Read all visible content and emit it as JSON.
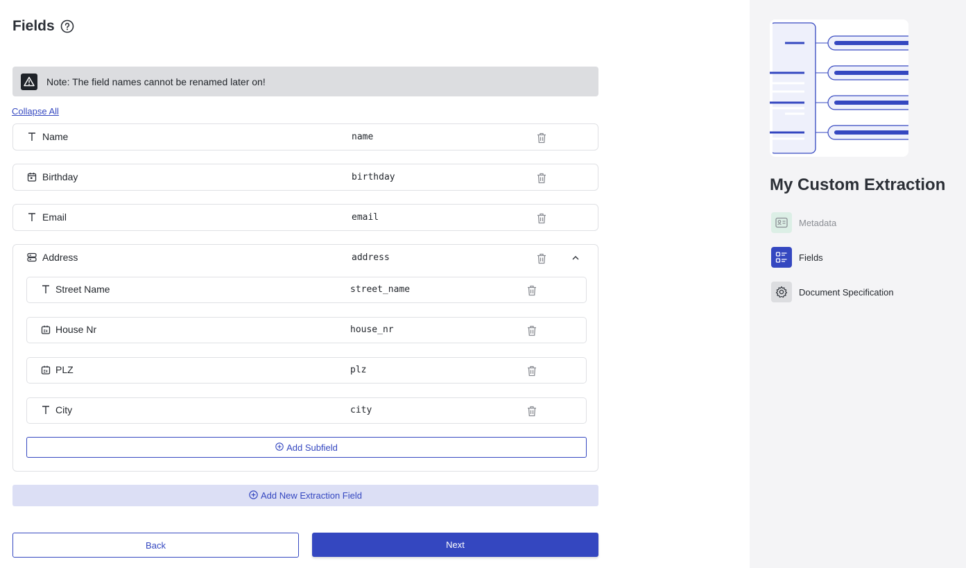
{
  "page": {
    "title": "Fields",
    "note": "Note: The field names cannot be renamed later on!",
    "collapse_all": "Collapse All"
  },
  "fields": [
    {
      "icon": "text-type-icon",
      "label": "Name",
      "key": "name"
    },
    {
      "icon": "calendar-icon",
      "label": "Birthday",
      "key": "birthday"
    },
    {
      "icon": "text-type-icon",
      "label": "Email",
      "key": "email"
    },
    {
      "icon": "group-icon",
      "label": "Address",
      "key": "address",
      "subfields": [
        {
          "icon": "text-type-icon",
          "label": "Street Name",
          "key": "street_name"
        },
        {
          "icon": "number-type-icon",
          "label": "House Nr",
          "key": "house_nr"
        },
        {
          "icon": "number-type-icon",
          "label": "PLZ",
          "key": "plz"
        },
        {
          "icon": "text-type-icon",
          "label": "City",
          "key": "city"
        }
      ]
    }
  ],
  "actions": {
    "add_subfield": "Add Subfield",
    "add_field": "Add New Extraction Field",
    "back": "Back",
    "next": "Next"
  },
  "sidebar": {
    "title": "My Custom Extraction",
    "steps": [
      {
        "label": "Metadata",
        "icon": "id-card-icon",
        "state": "completed"
      },
      {
        "label": "Fields",
        "icon": "list-icon",
        "state": "active"
      },
      {
        "label": "Document Specification",
        "icon": "gear-icon",
        "state": "pending"
      }
    ]
  },
  "colors": {
    "accent": "#3447c0",
    "note_bg": "#dcdde0",
    "add_field_bg": "#dcdff5",
    "sidebar_bg": "#f4f4f6"
  }
}
